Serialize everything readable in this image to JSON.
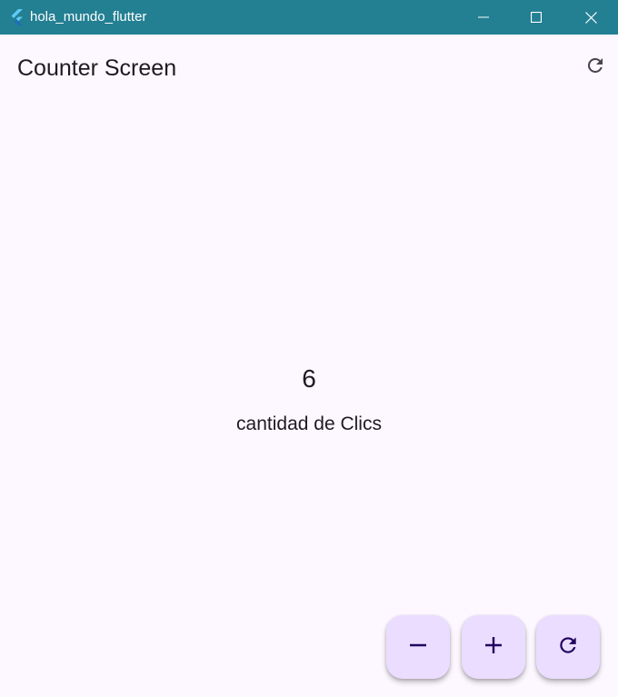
{
  "window": {
    "title": "hola_mundo_flutter",
    "titlebar_color": "#237f92",
    "controls": [
      "minimize-icon",
      "maximize-icon",
      "close-icon"
    ]
  },
  "appbar": {
    "title": "Counter Screen",
    "action_icon": "refresh-icon"
  },
  "counter": {
    "value": "6",
    "label": "cantidad de Clics"
  },
  "fabs": [
    {
      "icon": "minus-icon",
      "color": "#eaddff"
    },
    {
      "icon": "plus-icon",
      "color": "#eaddff"
    },
    {
      "icon": "refresh-icon",
      "color": "#eaddff"
    }
  ],
  "colors": {
    "background": "#fdf7ff",
    "fab_background": "#eaddff",
    "fab_icon": "#21005d",
    "text": "#1d1b20"
  }
}
